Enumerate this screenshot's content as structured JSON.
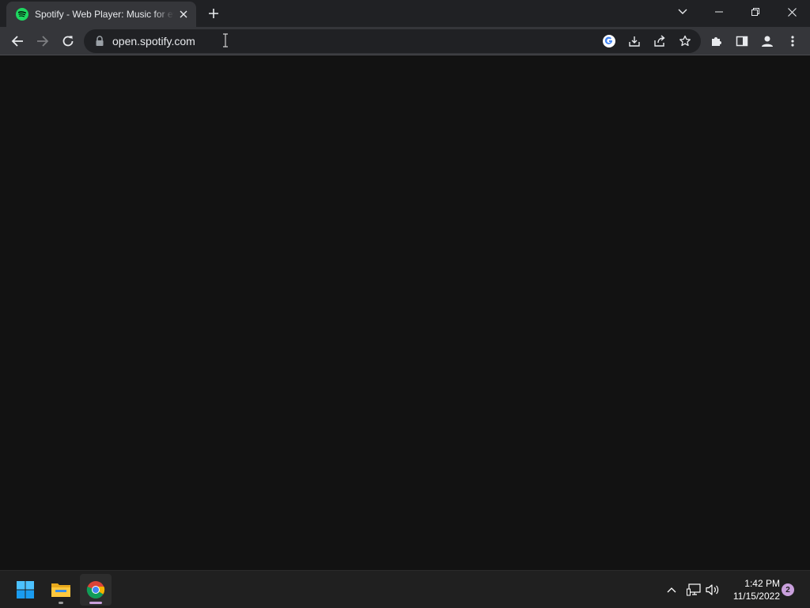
{
  "browser": {
    "tab": {
      "title": "Spotify - Web Player: Music for everyone",
      "favicon": "spotify-icon"
    },
    "address_bar": {
      "url": "open.spotify.com"
    }
  },
  "taskbar": {
    "apps": [
      "windows-start",
      "file-explorer",
      "google-chrome"
    ],
    "clock": {
      "time": "1:42 PM",
      "date": "11/15/2022"
    },
    "notification_count": "2"
  },
  "colors": {
    "page_background": "#121212",
    "toolbar": "#35363a",
    "tab_strip": "#202124",
    "spotify_green": "#1ed760",
    "taskbar": "#202020",
    "notification_badge": "#c9a0dc"
  }
}
